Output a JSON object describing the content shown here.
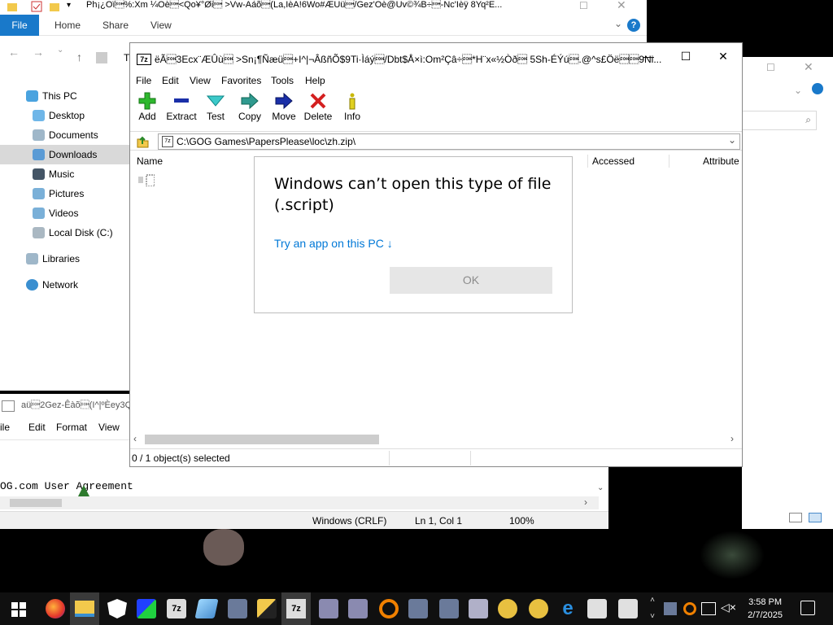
{
  "explorer": {
    "title": "Ph¡¿Oï\u0001%:Xm ¼Oè\u0001<Qo¥°Øi\u0001 >Vw-Aáõ\u0001(La,IèA!6Wo#ÆUü\u0001/Gez'Oè@Uv©¾B÷\u0001-Nc'Ièÿ 8Yq²E...",
    "ribbon_tabs": [
      "File",
      "Home",
      "Share",
      "View"
    ],
    "address_fragment": "T",
    "nav": [
      {
        "label": "This PC",
        "top": true,
        "icon": "this-pc-icon"
      },
      {
        "label": "Desktop",
        "icon": "desktop-folder-icon"
      },
      {
        "label": "Documents",
        "icon": "documents-folder-icon"
      },
      {
        "label": "Downloads",
        "icon": "downloads-folder-icon",
        "selected": true
      },
      {
        "label": "Music",
        "icon": "music-folder-icon"
      },
      {
        "label": "Pictures",
        "icon": "pictures-folder-icon"
      },
      {
        "label": "Videos",
        "icon": "videos-folder-icon"
      },
      {
        "label": "Local Disk (C:)",
        "icon": "local-disk-icon"
      },
      {
        "label": "Libraries",
        "top": true,
        "icon": "libraries-icon"
      },
      {
        "label": "Network",
        "top": true,
        "icon": "network-icon"
      }
    ]
  },
  "notepad": {
    "title": "aü\u00012Gez-Êàõ\u0001(I^|ºÈey3Q",
    "menu": [
      "ile",
      "Edit",
      "Format",
      "View"
    ],
    "content": "OG.com User Agreement",
    "status": {
      "encoding": "Windows (CRLF)",
      "position": "Ln 1, Col 1",
      "zoom": "100%"
    }
  },
  "zip": {
    "title": "ëÃ\u00013Ecx¨ÆÛù\u0001 >Sn¡¶Ñæü\u0001+I^|¬ÂßñÕ$9Ti·Ìáý\u0001/Dbt$Å×ì:Om²Çâ÷\u0001*H¨x«½Òð\u0001 5Sh-ÉÝú\u0001.@^s£Öë\u0001\u00019Ni...",
    "menu": [
      "File",
      "Edit",
      "View",
      "Favorites",
      "Tools",
      "Help"
    ],
    "tools": [
      {
        "label": "Add",
        "icon": "add-icon"
      },
      {
        "label": "Extract",
        "icon": "extract-icon"
      },
      {
        "label": "Test",
        "icon": "test-icon"
      },
      {
        "label": "Copy",
        "icon": "copy-icon"
      },
      {
        "label": "Move",
        "icon": "move-icon"
      },
      {
        "label": "Delete",
        "icon": "delete-icon"
      },
      {
        "label": "Info",
        "icon": "info-icon"
      }
    ],
    "path": "C:\\GOG Games\\PapersPlease\\loc\\zh.zip\\",
    "columns": [
      "Name",
      "Accessed",
      "Attribute"
    ],
    "status": "0 / 1 object(s) selected"
  },
  "dialog": {
    "title": "Windows can’t open this type of file (.script)",
    "link": "Try an app on this PC ↓",
    "ok": "OK"
  },
  "taskbar": {
    "time": "3:58 PM",
    "date": "2/7/2025"
  }
}
